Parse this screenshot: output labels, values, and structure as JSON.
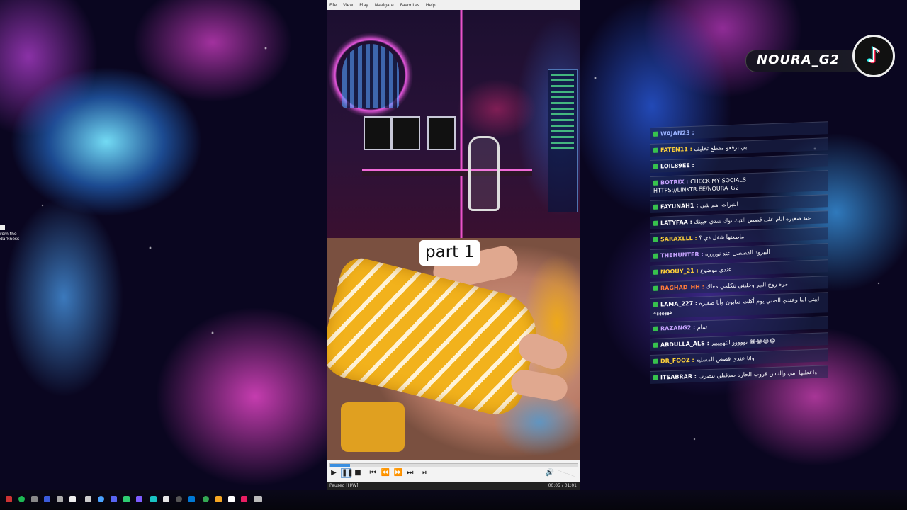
{
  "player": {
    "menu": [
      "File",
      "View",
      "Play",
      "Navigate",
      "Favorites",
      "Help"
    ],
    "caption": "part 1",
    "status": "Paused [H/W]",
    "time": "00:05 / 01:01",
    "progress": 0.08
  },
  "desktop": {
    "shortcut_label": "rom the\ndarkness"
  },
  "brand": {
    "name": "NOURA_G2",
    "logo_glyph": "♪"
  },
  "chat": [
    {
      "user": "WAJAN23 :",
      "text": "",
      "color": "#9ab3ff"
    },
    {
      "user": "FATEN11 :",
      "text": "ابي برقعو مقطع تخليف",
      "color": "#ffd23a"
    },
    {
      "user": "LOIL89EE :",
      "text": "",
      "color": "#ffffff"
    },
    {
      "user": "BOTRIX :",
      "text": "CHECK MY SOCIALS HTTPS://LINKTR.EE/NOURA_G2",
      "color": "#c7a3ff"
    },
    {
      "user": "FAYUNAH1 :",
      "text": "النبرات اهم شي",
      "color": "#ffffff"
    },
    {
      "user": "LATYFAA :",
      "text": "عند صغيره انام على قصص التيك توك شدي حبيتك",
      "color": "#ffffff"
    },
    {
      "user": "SARAXLLL :",
      "text": "ماطعتها شفل ذي ؟",
      "color": "#ffd23a"
    },
    {
      "user": "THEHUNTER :",
      "text": "البيرود القصصي عند نوررره",
      "color": "#c7a3ff"
    },
    {
      "user": "NOOUY_21 :",
      "text": "عندي موضوع",
      "color": "#ffd23a"
    },
    {
      "user": "RAGHAD_HH :",
      "text": "مرة روح البير وخليني تتكلمي معاك",
      "color": "#ff7a3a"
    },
    {
      "user": "LAMA_227 :",
      "text": "ابيتي ابيا وعندي الضتي يوم أكلت صابون وأنا صغيره ههههههه",
      "color": "#ffffff"
    },
    {
      "user": "RAZANG2 :",
      "text": "تمام",
      "color": "#c7a3ff"
    },
    {
      "user": "ABDULLA_ALS :",
      "text": "نووووو التهبيييير 😂😂😂😂",
      "color": "#ffffff"
    },
    {
      "user": "DR_FOOZ :",
      "text": "وانا عندي قصص المسليه",
      "color": "#ffd23a"
    },
    {
      "user": "ITSABRAR :",
      "text": "واعطيها امي والناس قروب الحاره صدقيلي بتضرب",
      "color": "#ffffff"
    }
  ],
  "colors": {
    "accent_blue": "#3a8fe0",
    "badge_green": "#37c24d"
  }
}
